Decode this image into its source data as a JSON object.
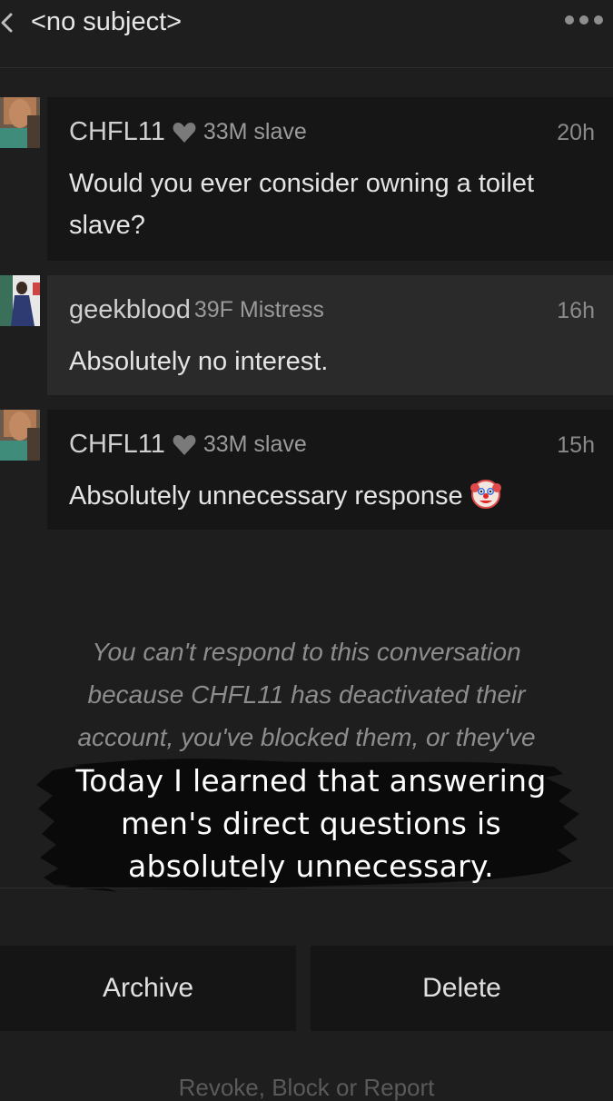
{
  "header": {
    "subject": "<no subject>",
    "back_icon": "chevron-left-icon",
    "more_icon": "more-horizontal-icon"
  },
  "messages": [
    {
      "username": "CHFL11",
      "badge_icon": "heart-shield-icon",
      "description": "33M slave",
      "time": "20h",
      "text": "Would you ever consider owning a toilet slave?"
    },
    {
      "username": "geekblood",
      "description": "39F Mistress",
      "time": "16h",
      "text": "Absolutely no interest."
    },
    {
      "username": "CHFL11",
      "badge_icon": "heart-shield-icon",
      "description": "33M slave",
      "time": "15h",
      "text": "Absolutely unnecessary response",
      "emoji": "clown-face-icon"
    }
  ],
  "notice": {
    "line1": "You can't respond to this conversation",
    "line2": "because CHFL11 has deactivated their",
    "line3": "account, you've blocked them, or they've"
  },
  "caption": {
    "line1": "Today I learned that answering",
    "line2": "men's direct questions is",
    "line3": "absolutely unnecessary."
  },
  "actions": {
    "archive_label": "Archive",
    "delete_label": "Delete",
    "footer_link": "Revoke, Block or Report"
  },
  "colors": {
    "background": "#1e1e1e",
    "message_dark": "#161616",
    "message_highlight": "#2a2a2a"
  }
}
